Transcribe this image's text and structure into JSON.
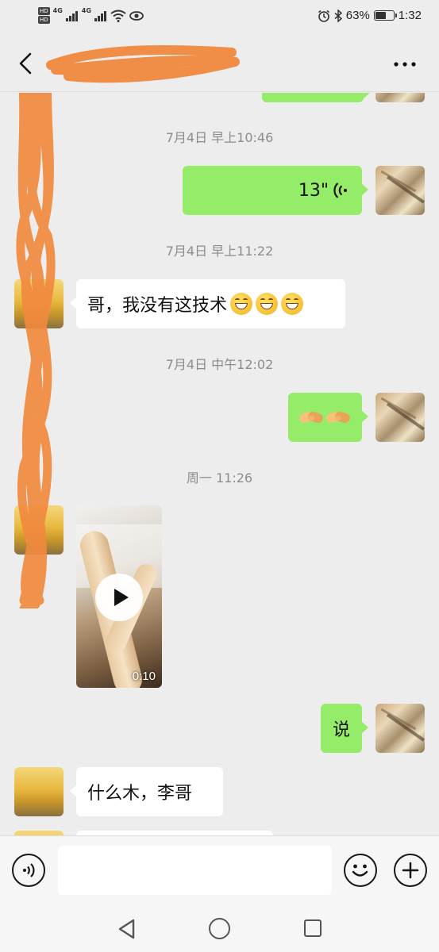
{
  "status_bar": {
    "hd_tags": [
      "HD",
      "HD"
    ],
    "net_labels": [
      "4G",
      "4G"
    ],
    "battery_percent": "63%",
    "battery_level": 0.63,
    "time": "1:32"
  },
  "header": {
    "title": "",
    "back_icon": "chevron-left-icon",
    "more_icon": "more-dots-icon"
  },
  "messages": [
    {
      "kind": "time",
      "text": "7月4日 早上10:46"
    },
    {
      "kind": "voice",
      "side": "me",
      "duration": "13\""
    },
    {
      "kind": "time",
      "text": "7月4日 早上11:22"
    },
    {
      "kind": "text",
      "side": "them",
      "text": "哥，我没有这技术",
      "emoji": [
        "grinning-face",
        "grinning-face",
        "grinning-face"
      ]
    },
    {
      "kind": "time",
      "text": "7月4日 中午12:02"
    },
    {
      "kind": "emoji",
      "side": "me",
      "emoji": [
        "handshake",
        "handshake"
      ]
    },
    {
      "kind": "time",
      "text": "周一 11:26"
    },
    {
      "kind": "video",
      "side": "them",
      "duration": "0:10"
    },
    {
      "kind": "text",
      "side": "me",
      "text": "说"
    },
    {
      "kind": "text",
      "side": "them",
      "text": "什么木，李哥"
    }
  ],
  "input_bar": {
    "input_value": "",
    "voice_icon": "voice-input-icon",
    "emoji_icon": "emoji-icon",
    "plus_icon": "plus-icon"
  },
  "system_nav": {
    "back_icon": "triangle-back-icon",
    "home_icon": "circle-home-icon",
    "recent_icon": "square-recent-icon"
  },
  "colors": {
    "my_bubble": "#95ec69",
    "their_bubble": "#ffffff",
    "background": "#ededed",
    "redaction_scribble": "#f0893e"
  }
}
